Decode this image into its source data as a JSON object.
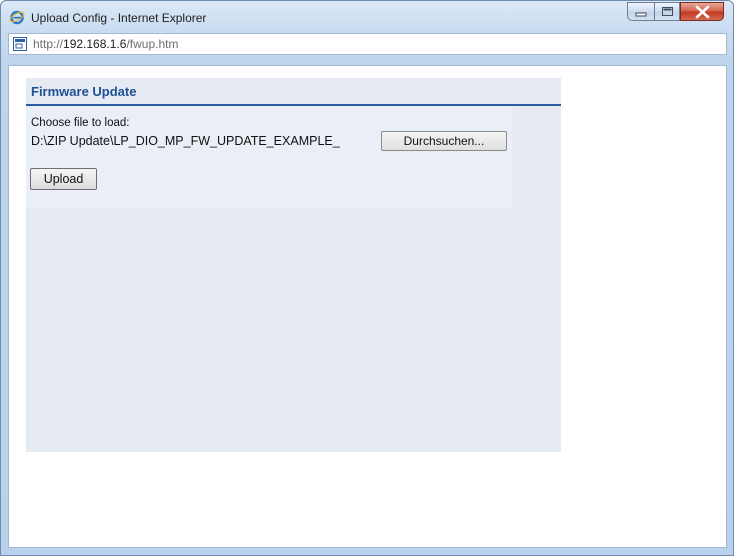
{
  "window": {
    "title": "Upload Config - Internet Explorer",
    "icon": "internet-explorer-icon",
    "controls": [
      "minimize-icon",
      "maximize-icon",
      "close-icon"
    ]
  },
  "address": {
    "url_prefix": "http://",
    "url_host": "192.168.1.6",
    "url_path": "/fwup.htm",
    "icon": "page-icon"
  },
  "panel": {
    "title": "Firmware Update",
    "choose_label": "Choose file to load:",
    "file_path": "D:\\ZIP Update\\LP_DIO_MP_FW_UPDATE_EXAMPLE_",
    "browse_label": "Durchsuchen...",
    "upload_label": "Upload"
  },
  "colors": {
    "panel_bg": "#e5eaf3",
    "title_color": "#1f4f95",
    "rule_color": "#2d5ba0",
    "close_button": "#c23a22"
  }
}
